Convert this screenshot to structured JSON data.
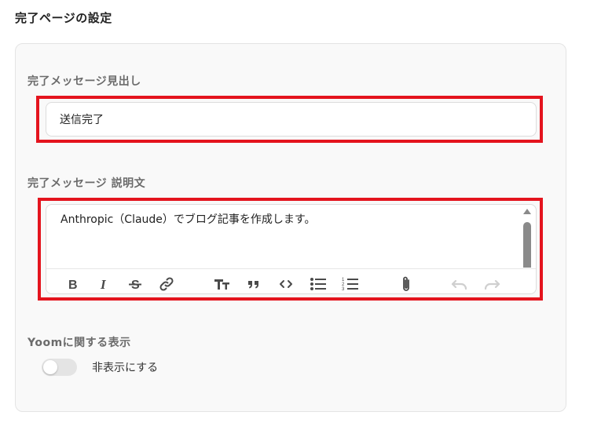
{
  "section": {
    "title": "完了ページの設定"
  },
  "heading_field": {
    "label": "完了メッセージ見出し",
    "value": "送信完了"
  },
  "description_field": {
    "label": "完了メッセージ 説明文",
    "value": "Anthropic（Claude）でブログ記事を作成します。",
    "toolbar": [
      {
        "icon": "bold-icon",
        "enabled": true
      },
      {
        "icon": "italic-icon",
        "enabled": true
      },
      {
        "icon": "strikethrough-icon",
        "enabled": true
      },
      {
        "icon": "link-icon",
        "enabled": true
      },
      {
        "icon": "heading-icon",
        "enabled": true
      },
      {
        "icon": "quote-icon",
        "enabled": true
      },
      {
        "icon": "code-icon",
        "enabled": true
      },
      {
        "icon": "bullet-list-icon",
        "enabled": true
      },
      {
        "icon": "numbered-list-icon",
        "enabled": true
      },
      {
        "icon": "attachment-icon",
        "enabled": true
      },
      {
        "icon": "undo-icon",
        "enabled": false
      },
      {
        "icon": "redo-icon",
        "enabled": false
      }
    ]
  },
  "yoom_display": {
    "label": "Yoomに関する表示",
    "toggle_label": "非表示にする",
    "toggle_on": false
  },
  "colors": {
    "highlight": "#e4141e",
    "label_gray": "#6b6b6b",
    "card_bg": "#f9f9f9"
  }
}
